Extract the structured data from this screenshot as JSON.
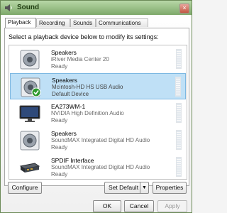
{
  "window": {
    "title": "Sound",
    "close_glyph": "×"
  },
  "tabs": [
    {
      "label": "Playback"
    },
    {
      "label": "Recording"
    },
    {
      "label": "Sounds"
    },
    {
      "label": "Communications"
    }
  ],
  "instruction": "Select a playback device below to modify its settings:",
  "devices": [
    {
      "name": "Speakers",
      "detail1": "iRiver Media Center 20",
      "detail2": "Ready",
      "icon": "speaker-icon"
    },
    {
      "name": "Speakers",
      "detail1": "Mcintosh-HD HS USB Audio",
      "detail2": "Default Device",
      "icon": "speaker-default-icon"
    },
    {
      "name": "EA273WM-1",
      "detail1": "NVIDIA High Definition Audio",
      "detail2": "Ready",
      "icon": "monitor-icon"
    },
    {
      "name": "Speakers",
      "detail1": "SoundMAX Integrated Digital HD Audio",
      "detail2": "Ready",
      "icon": "speaker-icon"
    },
    {
      "name": "SPDIF Interface",
      "detail1": "SoundMAX Integrated Digital HD Audio",
      "detail2": "Ready",
      "icon": "spdif-icon"
    }
  ],
  "buttons": {
    "configure": "Configure",
    "set_default": "Set Default",
    "properties": "Properties",
    "ok": "OK",
    "cancel": "Cancel",
    "apply": "Apply"
  },
  "colors": {
    "selection": "#bfe0f6",
    "default_check": "#2e9a2e",
    "titlebar": "#7ea96a"
  }
}
